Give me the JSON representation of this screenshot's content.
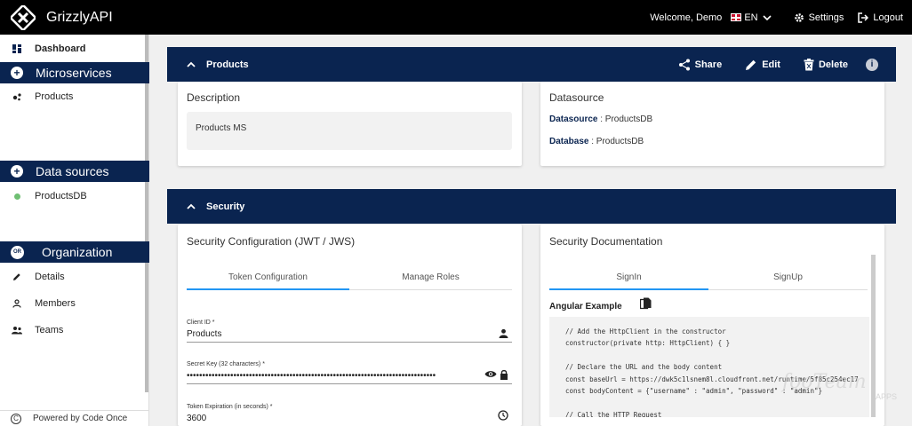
{
  "app": {
    "title": "GrizzlyAPI"
  },
  "topbar": {
    "welcome": "Welcome, Demo",
    "language": "EN",
    "settings_label": "Settings",
    "logout_label": "Logout"
  },
  "sidebar": {
    "dashboard_label": "Dashboard",
    "microservices": {
      "title": "Microservices",
      "items": [
        "Products"
      ]
    },
    "datasources": {
      "title": "Data sources",
      "items": [
        "ProductsDB"
      ]
    },
    "organization": {
      "title": "Organization",
      "badge": "OR",
      "items": [
        {
          "label": "Details",
          "icon": "pencil-icon"
        },
        {
          "label": "Members",
          "icon": "person-icon"
        },
        {
          "label": "Teams",
          "icon": "people-icon"
        }
      ]
    },
    "footer": "Powered by Code Once"
  },
  "products_panel": {
    "title": "Products",
    "actions": {
      "share": "Share",
      "edit": "Edit",
      "delete": "Delete"
    },
    "description": {
      "title": "Description",
      "value": "Products MS"
    },
    "datasource": {
      "title": "Datasource",
      "datasource_key": "Datasource",
      "datasource_value": " : ProductsDB",
      "database_key": "Database",
      "database_value": " : ProductsDB"
    }
  },
  "security_panel": {
    "title": "Security",
    "config": {
      "title": "Security Configuration (JWT / JWS)",
      "tabs": [
        "Token Configuration",
        "Manage Roles"
      ],
      "client_id": {
        "label": "Client ID *",
        "value": "Products"
      },
      "secret_key": {
        "label": "Secret Key (32 characters) *",
        "value": "••••••••••••••••••••••••••••••••••••••••••••••••••••••••••••••••••••••••••••••••"
      },
      "token_expiration": {
        "label": "Token Expiration (in seconds) *",
        "value": "3600"
      }
    },
    "docs": {
      "title": "Security Documentation",
      "tabs": [
        "SignIn",
        "SignUp"
      ],
      "example_title": "Angular Example",
      "code": "// Add the HttpClient in the constructor\nconstructor(private http: HttpClient) { }\n\n// Declare the URL and the body content\nconst baseUrl = https://dwk5c1lsnem8l.cloudfront.net/runtime/5f85c254ec17\nconst bodyContent = {\"username\" : \"admin\", \"password\" : \"admin\"}\n\n// Call the HTTP Request"
    }
  },
  "watermark": {
    "brand": "fooTeam",
    "sub": "APPS"
  },
  "colors": {
    "navy": "#0a2450",
    "accent": "#2196f3",
    "status_ok": "#6fbf73"
  }
}
